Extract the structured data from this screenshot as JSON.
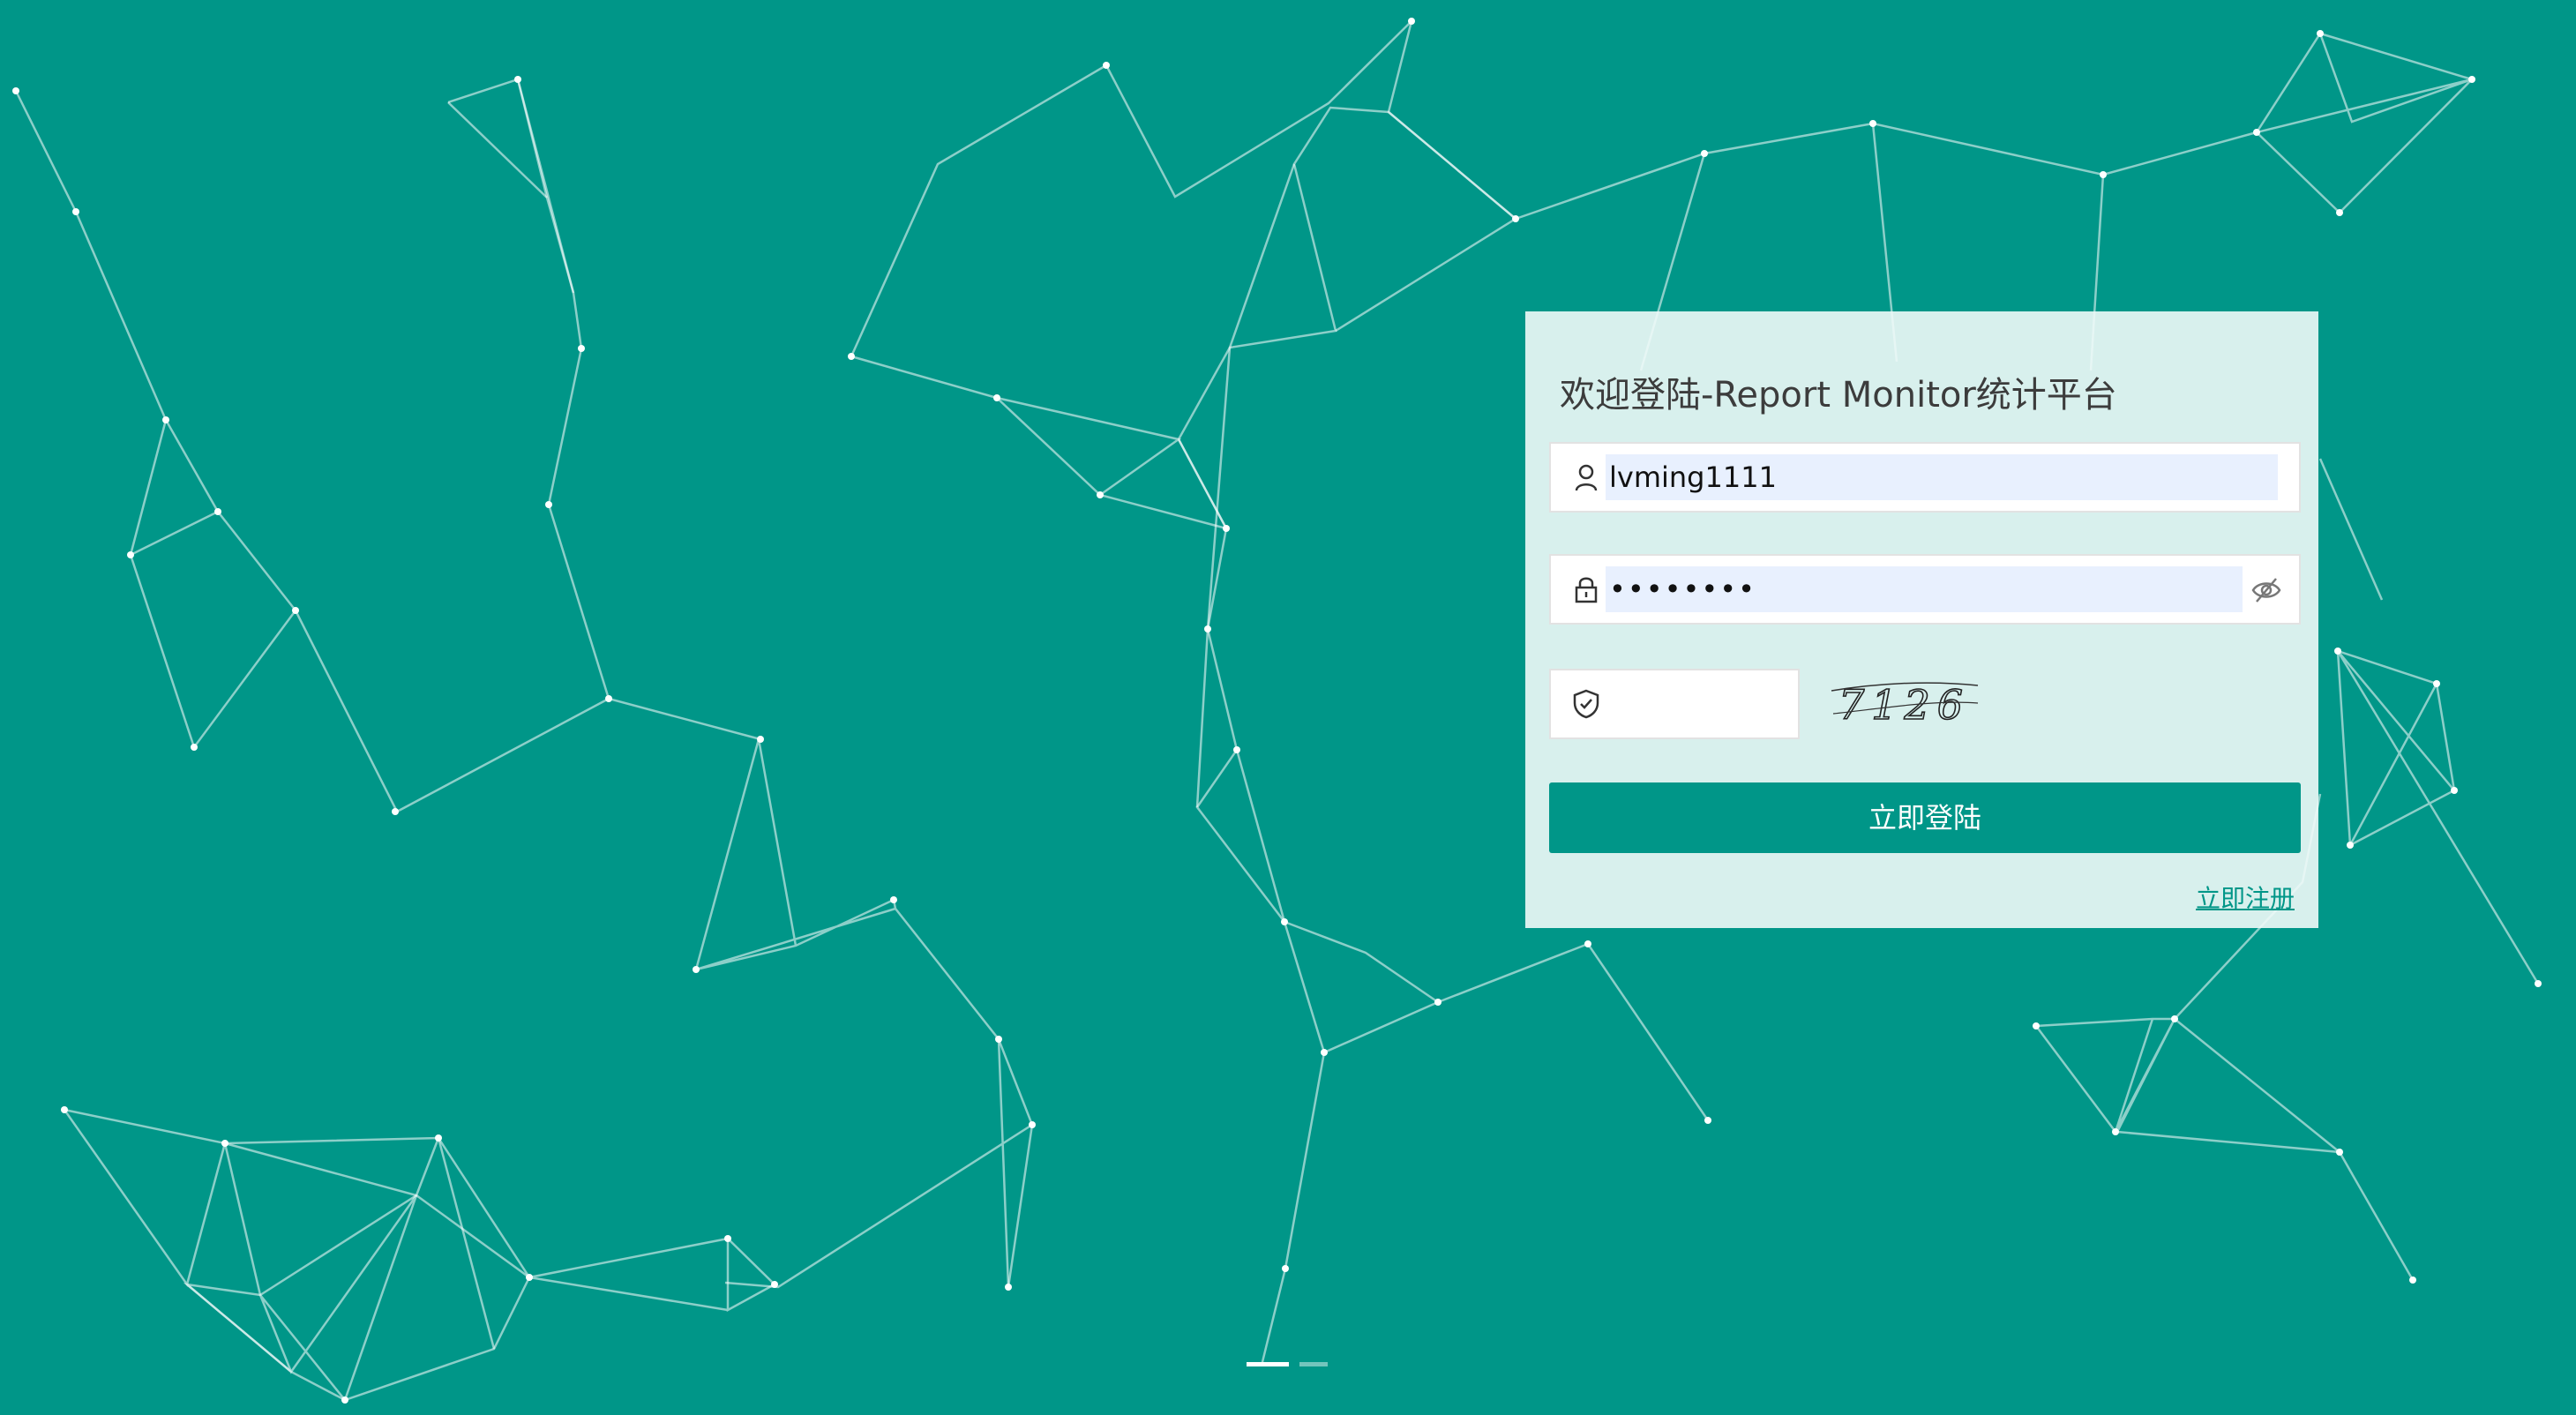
{
  "login": {
    "title": "欢迎登陆-Report Monitor统计平台",
    "username": {
      "value": "lvming1111",
      "icon": "user-icon"
    },
    "password": {
      "value": "••••••••",
      "icon": "lock-icon",
      "toggle_icon": "eye-slash-icon"
    },
    "captcha": {
      "value": "",
      "icon": "shield-check-icon",
      "image_text": "7126"
    },
    "submit_label": "立即登陆",
    "register_label": "立即注册"
  },
  "carousel": {
    "count": 2,
    "active_index": 0
  },
  "colors": {
    "background": "#009688",
    "accent": "#009688",
    "autofill": "#e8f0fe"
  }
}
